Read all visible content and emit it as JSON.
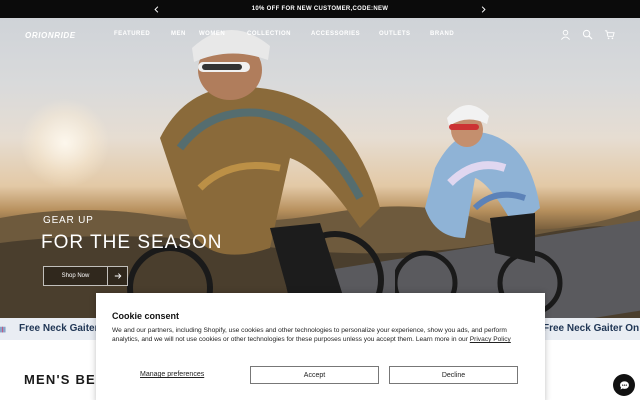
{
  "announcement": {
    "text": "10% OFF FOR NEW CUSTOMER,CODE:NEW"
  },
  "header": {
    "logo": "ORIONRIDE",
    "nav": [
      "FEATURED",
      "MEN",
      "WOMEN",
      "COLLECTION",
      "ACCESSORIES",
      "OUTLETS",
      "BRAND"
    ],
    "icons": [
      "account-icon",
      "search-icon",
      "cart-icon"
    ]
  },
  "hero": {
    "eyebrow": "GEAR UP",
    "headline": "FOR THE SEASON",
    "cta_label": "Shop Now"
  },
  "marquee": {
    "items": [
      "Free Neck Gaiter O",
      "Free Neck Gaiter On On"
    ]
  },
  "section": {
    "title": "MEN'S BE"
  },
  "cookie": {
    "title": "Cookie consent",
    "body": "We and our partners, including Shopify, use cookies and other technologies to personalize your experience, show you ads, and perform analytics, and we will not use cookies or other technologies for these purposes unless you accept them. Learn more in our",
    "policy_link": "Privacy Policy",
    "manage_label": "Manage preferences",
    "accept_label": "Accept",
    "decline_label": "Decline"
  },
  "colors": {
    "announce_bg": "#0b0b0b",
    "marquee_bg": "#e9edf3",
    "marquee_text": "#1f3554"
  }
}
